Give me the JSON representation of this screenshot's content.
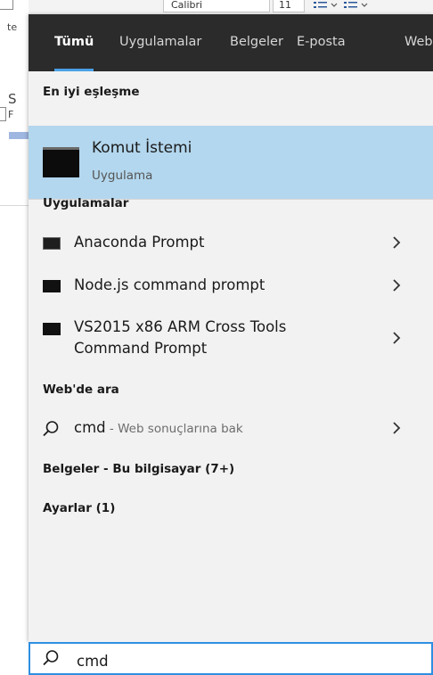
{
  "background": {
    "ribbon_font": "Calibri",
    "ribbon_size": "11",
    "left_fragment_top": "te",
    "left_fragment_s": "S",
    "left_fragment_p": "F"
  },
  "tabs": [
    {
      "label": "Tümü",
      "active": true
    },
    {
      "label": "Uygulamalar",
      "active": false
    },
    {
      "label": "Belgeler",
      "active": false
    },
    {
      "label": "E-posta",
      "active": false
    },
    {
      "label": "Web",
      "active": false
    }
  ],
  "best_match": {
    "section_title": "En iyi eşleşme",
    "name": "Komut İstemi",
    "type": "Uygulama",
    "icon": "command-prompt-icon"
  },
  "apps": {
    "section_title": "Uygulamalar",
    "items": [
      {
        "label": "Anaconda Prompt",
        "icon": "anaconda-prompt-icon"
      },
      {
        "label": "Node.js command prompt",
        "icon": "nodejs-prompt-icon"
      },
      {
        "label_line1": "VS2015 x86 ARM Cross Tools",
        "label_line2": "Command Prompt",
        "icon": "vs-prompt-icon"
      }
    ]
  },
  "web": {
    "section_title": "Web'de ara",
    "query": "cmd",
    "suffix": " - Web sonuçlarına bak",
    "icon": "search-icon"
  },
  "documents": {
    "section_title": "Belgeler - Bu bilgisayar (7+)"
  },
  "settings": {
    "section_title": "Ayarlar (1)"
  },
  "searchbox": {
    "value": "cmd",
    "icon": "search-icon"
  },
  "colors": {
    "tabbar_bg": "#2b2b2b",
    "accent": "#4aa0e6",
    "highlight": "#b3d7ee",
    "panel_bg": "#f2f2f2"
  }
}
